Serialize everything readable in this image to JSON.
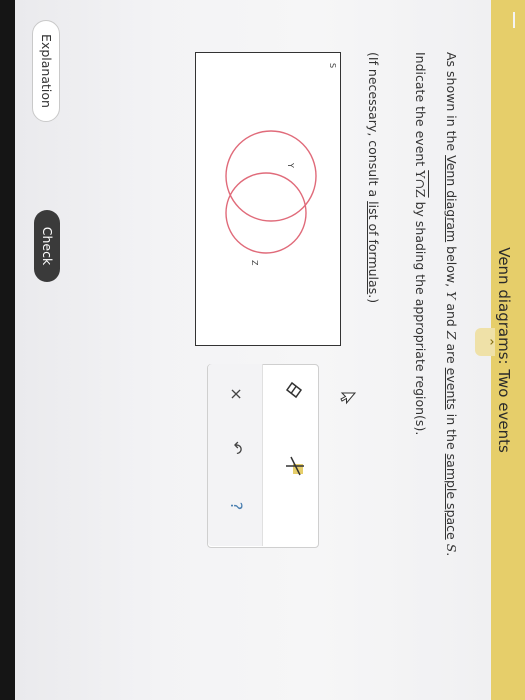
{
  "header": {
    "title": "Venn diagrams: Two events",
    "collapse_icon": "chevron-up-icon"
  },
  "question": {
    "line1_parts": [
      "As shown in the ",
      "Venn diagram",
      " below, ",
      "Y",
      " and ",
      "Z",
      " are ",
      "events",
      " in the ",
      "sample space",
      " ",
      "S",
      "."
    ],
    "line2_parts": [
      "Indicate the event ",
      "Y∩Z",
      " by shading the appropriate region(s)."
    ],
    "line3_parts": [
      "(If necessary, consult a ",
      "list of formulas",
      ".)"
    ]
  },
  "venn": {
    "sample_space_label": "S",
    "set1_label": "Y",
    "set2_label": "Z",
    "circle_color": "#e06b7a"
  },
  "tools": {
    "eraser_icon": "eraser-icon",
    "shade_icon": "shade-icon",
    "clear_label": "×",
    "undo_label": "↶",
    "help_label": "?"
  },
  "buttons": {
    "explanation": "Explanation",
    "check": "Check"
  },
  "colors": {
    "header_bg": "#e6ce6a",
    "circle": "#e06b7a",
    "check_bg": "#3a3a3a"
  }
}
